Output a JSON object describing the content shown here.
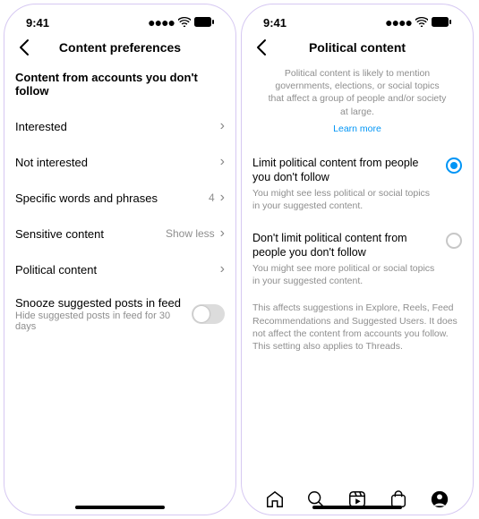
{
  "status": {
    "time": "9:41",
    "signal": "••••",
    "wifi": "",
    "battery": ""
  },
  "left": {
    "header": {
      "title": "Content preferences"
    },
    "section_title": "Content from accounts you don't follow",
    "rows": {
      "interested": {
        "label": "Interested"
      },
      "not_interested": {
        "label": "Not interested"
      },
      "specific_words": {
        "label": "Specific words and phrases",
        "value": "4"
      },
      "sensitive": {
        "label": "Sensitive content",
        "value": "Show less"
      },
      "political": {
        "label": "Political content"
      },
      "snooze": {
        "label": "Snooze suggested posts in feed",
        "sub": "Hide suggested posts in feed for 30 days"
      }
    }
  },
  "right": {
    "header": {
      "title": "Political content"
    },
    "description": "Political content is likely to mention governments, elections, or social topics that affect a group of people and/or society at large.",
    "learn_more": "Learn more",
    "options": {
      "limit": {
        "title": "Limit political content from people you don't follow",
        "sub": "You might see less political or social topics in your suggested content."
      },
      "dont_limit": {
        "title": "Don't limit political content from people you don't follow",
        "sub": "You might see more political or social topics in your suggested content."
      }
    },
    "footnote": "This affects suggestions in Explore, Reels, Feed Recommendations and Suggested Users. It does not affect the content from accounts you follow. This setting also applies to Threads."
  }
}
